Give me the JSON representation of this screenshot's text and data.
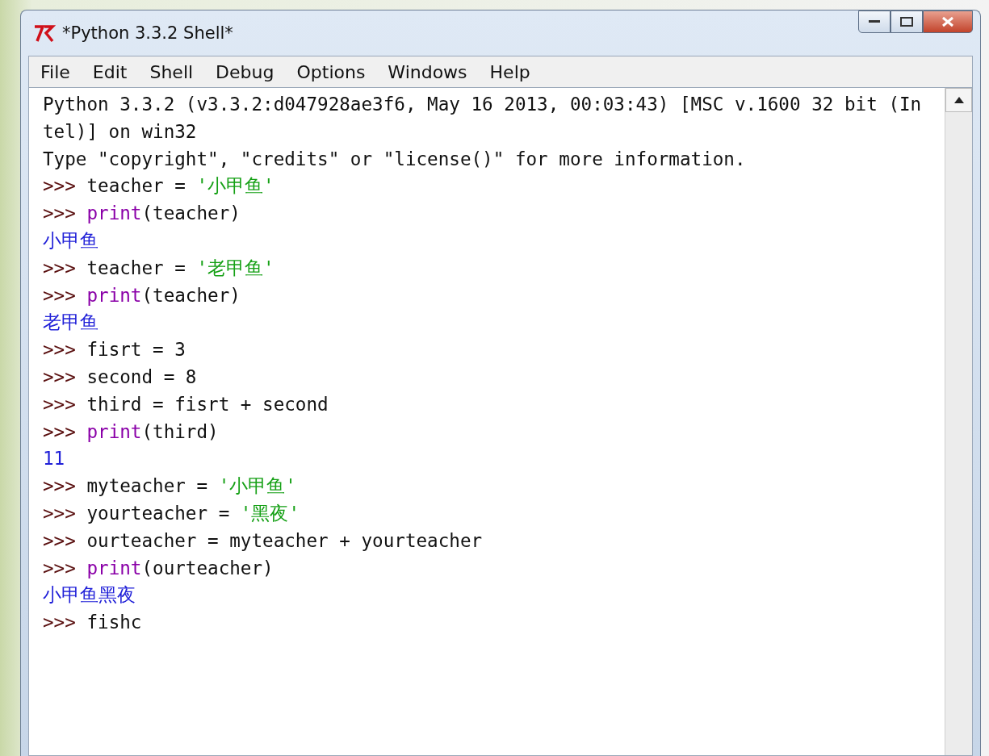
{
  "window": {
    "title": "*Python 3.3.2 Shell*"
  },
  "menu": [
    "File",
    "Edit",
    "Shell",
    "Debug",
    "Options",
    "Windows",
    "Help"
  ],
  "shell_lines": [
    [
      {
        "kind": "text",
        "text": "Python 3.3.2 (v3.3.2:d047928ae3f6, May 16 2013, 00:03:43) [MSC v.1600 32 bit (In"
      }
    ],
    [
      {
        "kind": "text",
        "text": "tel)] on win32"
      }
    ],
    [
      {
        "kind": "text",
        "text": "Type \"copyright\", \"credits\" or \"license()\" for more information."
      }
    ],
    [
      {
        "kind": "prompt",
        "text": ">>> "
      },
      {
        "kind": "code",
        "text": "teacher = "
      },
      {
        "kind": "string",
        "text": "'小甲鱼'"
      }
    ],
    [
      {
        "kind": "prompt",
        "text": ">>> "
      },
      {
        "kind": "builtin",
        "text": "print"
      },
      {
        "kind": "code",
        "text": "(teacher)"
      }
    ],
    [
      {
        "kind": "output",
        "text": "小甲鱼"
      }
    ],
    [
      {
        "kind": "prompt",
        "text": ">>> "
      },
      {
        "kind": "code",
        "text": "teacher = "
      },
      {
        "kind": "string",
        "text": "'老甲鱼'"
      }
    ],
    [
      {
        "kind": "prompt",
        "text": ">>> "
      },
      {
        "kind": "builtin",
        "text": "print"
      },
      {
        "kind": "code",
        "text": "(teacher)"
      }
    ],
    [
      {
        "kind": "output",
        "text": "老甲鱼"
      }
    ],
    [
      {
        "kind": "prompt",
        "text": ">>> "
      },
      {
        "kind": "code",
        "text": "fisrt = 3"
      }
    ],
    [
      {
        "kind": "prompt",
        "text": ">>> "
      },
      {
        "kind": "code",
        "text": "second = 8"
      }
    ],
    [
      {
        "kind": "prompt",
        "text": ">>> "
      },
      {
        "kind": "code",
        "text": "third = fisrt + second"
      }
    ],
    [
      {
        "kind": "prompt",
        "text": ">>> "
      },
      {
        "kind": "builtin",
        "text": "print"
      },
      {
        "kind": "code",
        "text": "(third)"
      }
    ],
    [
      {
        "kind": "output",
        "text": "11"
      }
    ],
    [
      {
        "kind": "prompt",
        "text": ">>> "
      },
      {
        "kind": "code",
        "text": "myteacher = "
      },
      {
        "kind": "string",
        "text": "'小甲鱼'"
      }
    ],
    [
      {
        "kind": "prompt",
        "text": ">>> "
      },
      {
        "kind": "code",
        "text": "yourteacher = "
      },
      {
        "kind": "string",
        "text": "'黑夜'"
      }
    ],
    [
      {
        "kind": "prompt",
        "text": ">>> "
      },
      {
        "kind": "code",
        "text": "ourteacher = myteacher + yourteacher"
      }
    ],
    [
      {
        "kind": "prompt",
        "text": ">>> "
      },
      {
        "kind": "builtin",
        "text": "print"
      },
      {
        "kind": "code",
        "text": "(ourteacher)"
      }
    ],
    [
      {
        "kind": "output",
        "text": "小甲鱼黑夜"
      }
    ],
    [
      {
        "kind": "prompt",
        "text": ">>> "
      },
      {
        "kind": "code",
        "text": "fishc"
      }
    ]
  ]
}
